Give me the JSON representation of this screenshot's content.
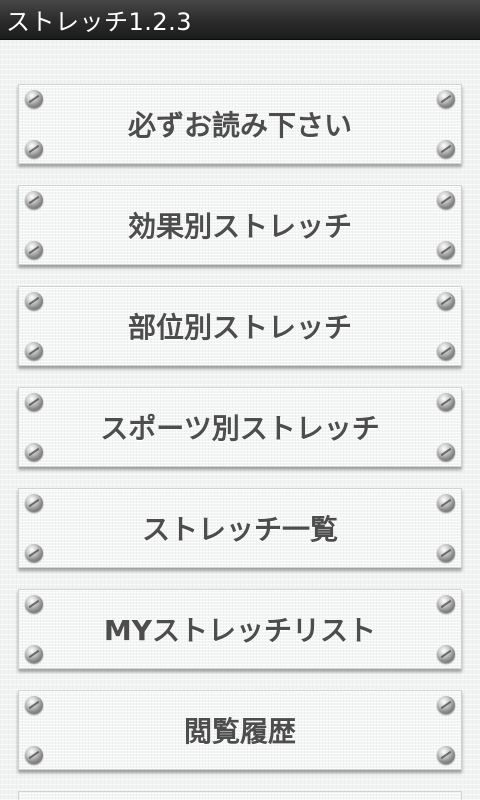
{
  "app": {
    "title": "ストレッチ1.2.3"
  },
  "menu": {
    "items": [
      {
        "id": "read-first",
        "label": "必ずお読み下さい"
      },
      {
        "id": "by-effect",
        "label": "効果別ストレッチ"
      },
      {
        "id": "by-body-part",
        "label": "部位別ストレッチ"
      },
      {
        "id": "by-sport",
        "label": "スポーツ別ストレッチ"
      },
      {
        "id": "stretch-list",
        "label": "ストレッチ一覧"
      },
      {
        "id": "my-stretch-list",
        "label": "MYストレッチリスト"
      },
      {
        "id": "history",
        "label": "閲覧履歴"
      }
    ]
  },
  "colors": {
    "titlebar": "#2b2b2b",
    "title_text": "#ffffff",
    "background": "#f1f3f3",
    "plate": "#f4f5f5",
    "label_text": "#4d4d4d"
  },
  "icons": {
    "bolt": "screw-icon"
  }
}
